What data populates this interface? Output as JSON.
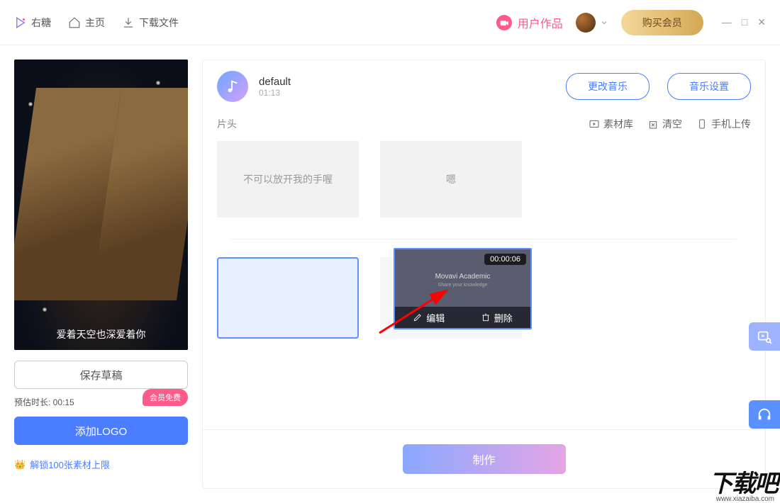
{
  "header": {
    "brand": "右糖",
    "home": "主页",
    "download": "下载文件",
    "user_works": "用户作品",
    "buy_vip": "购买会员"
  },
  "sidebar": {
    "preview_caption": "爱着天空也深爱着你",
    "save_draft": "保存草稿",
    "duration_label": "预估时长: 00:15",
    "vip_badge": "会员免费",
    "add_logo": "添加LOGO",
    "unlock": "解锁100张素材上限"
  },
  "music": {
    "name": "default",
    "time": "01:13",
    "change": "更改音乐",
    "settings": "音乐设置"
  },
  "section": {
    "title": "片头",
    "library": "素材库",
    "clear": "清空",
    "mobile_upload": "手机上传"
  },
  "clips": {
    "tile1": "不可以放开我的手喔",
    "tile2": "嗯"
  },
  "floating": {
    "duration": "00:00:06",
    "title": "Movavi Academic",
    "subtitle": "Share your knowledge",
    "edit": "编辑",
    "delete": "删除"
  },
  "bottom": {
    "make": "制作"
  },
  "watermark": {
    "logo": "下载吧",
    "url": "www.xiazaiba.com"
  }
}
